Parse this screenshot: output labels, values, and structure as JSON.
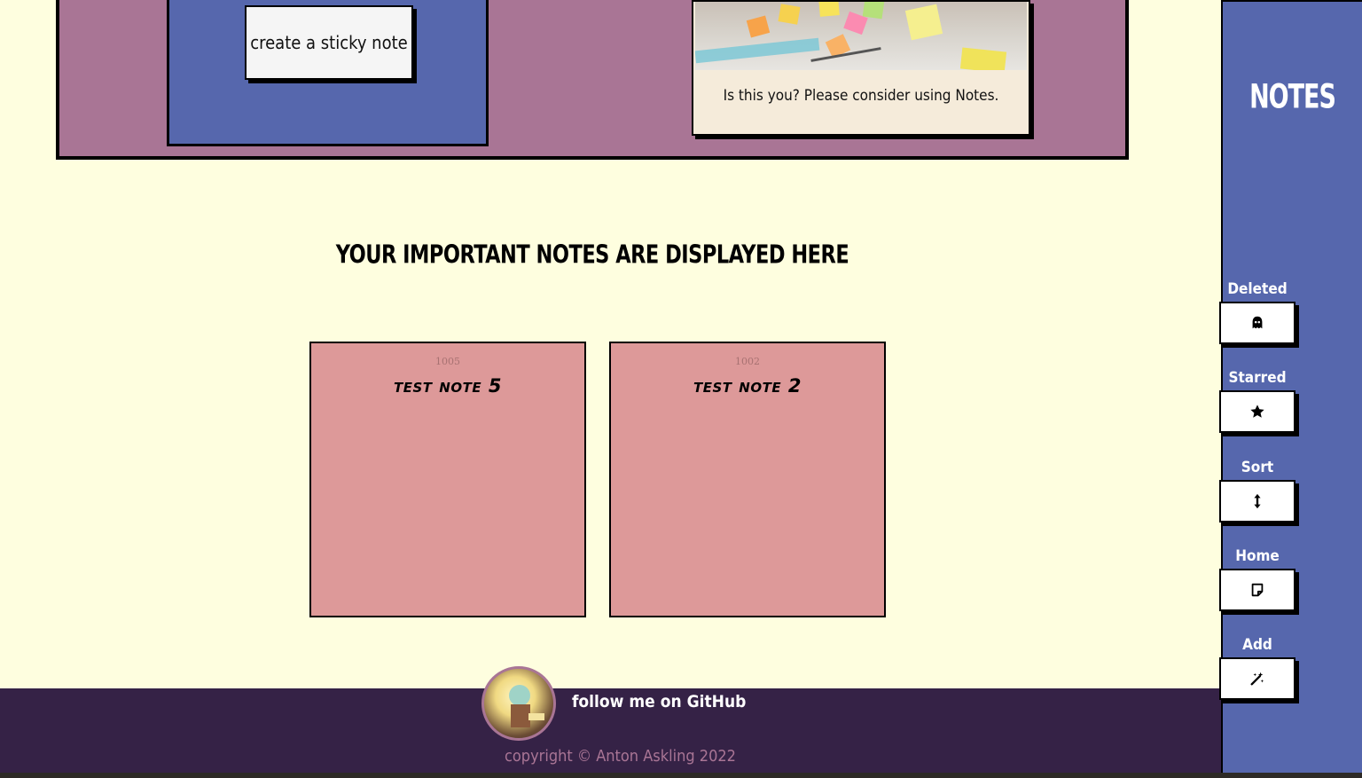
{
  "hero": {
    "create_button_label": "create a sticky note",
    "caption": "Is this you? Please consider using Notes."
  },
  "main": {
    "heading": "Your important notes are displayed here",
    "notes": [
      {
        "id": "1005",
        "title": "test note 5"
      },
      {
        "id": "1002",
        "title": "test note 2"
      }
    ]
  },
  "footer": {
    "github_link": "follow me on GitHub",
    "copyright": "copyright © Anton Askling 2022"
  },
  "sidebar": {
    "title": "NOTES",
    "items": [
      {
        "label": "Deleted",
        "icon": "ghost-icon"
      },
      {
        "label": "Starred",
        "icon": "star-icon"
      },
      {
        "label": "Sort",
        "icon": "sort-arrows-icon"
      },
      {
        "label": "Home",
        "icon": "sticky-note-icon"
      },
      {
        "label": "Add",
        "icon": "magic-wand-icon"
      }
    ]
  },
  "colors": {
    "page_bg": "#fefedf",
    "hero_bg": "#a97595",
    "panel_blue": "#5667ad",
    "note_bg": "#dd9999",
    "footer_bg": "#352246"
  }
}
